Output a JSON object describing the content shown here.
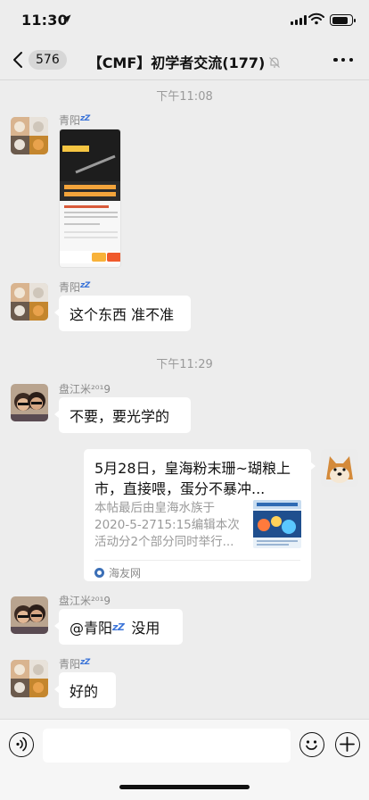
{
  "status_bar": {
    "time": "11:30"
  },
  "nav": {
    "unread_count": "576",
    "title": "【CMF】初学者交流(177)"
  },
  "messages": {
    "time_1": "下午11:08",
    "m1_sender": "青阳",
    "m2_sender": "青阳",
    "m2_text": "这个东西 准不准",
    "time_2": "下午11:29",
    "m3_sender": "盘江米²⁰¹9",
    "m3_text": "不要，要光学的",
    "m4_link_title": "5月28日，皇海粉末珊~瑚粮上市，直接喂，蛋分不暴冲...",
    "m4_link_desc": "本帖最后由皇海水族于2020-5-2715:15编辑本次活动分2个部分同时举行...",
    "m4_link_source": "海友网",
    "m5_sender": "盘江米²⁰¹9",
    "m5_mention": "@青阳",
    "m5_text": "没用",
    "m6_sender": "青阳",
    "m6_text": "好的"
  },
  "icons": {
    "zzz": "zzz"
  },
  "colors": {
    "background": "#ededed",
    "bubble": "#ffffff",
    "timestamp": "#9a9a9a",
    "zzz": "#3b74d8"
  }
}
